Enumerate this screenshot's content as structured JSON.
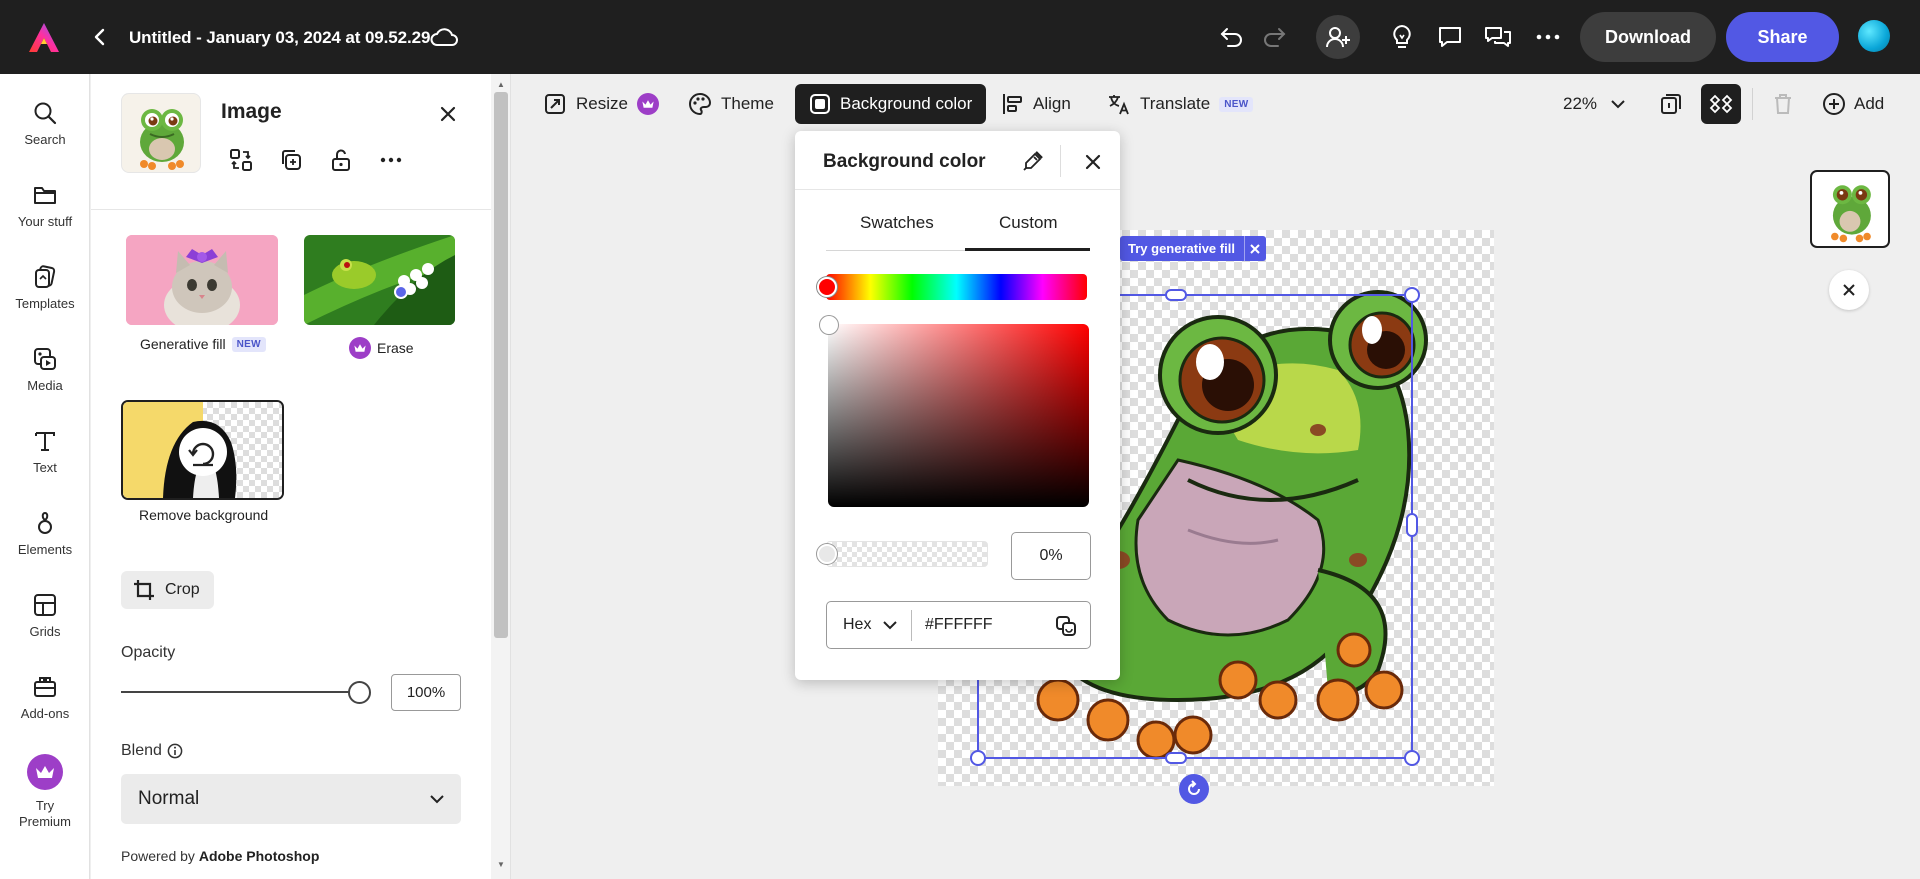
{
  "header": {
    "doc_title": "Untitled - January 03, 2024 at 09.52.29",
    "download_label": "Download",
    "share_label": "Share"
  },
  "rail": {
    "items": [
      {
        "label": "Search",
        "icon": "search-icon"
      },
      {
        "label": "Your stuff",
        "icon": "folder-icon"
      },
      {
        "label": "Templates",
        "icon": "templates-icon"
      },
      {
        "label": "Media",
        "icon": "media-icon"
      },
      {
        "label": "Text",
        "icon": "text-icon"
      },
      {
        "label": "Elements",
        "icon": "elements-icon"
      },
      {
        "label": "Grids",
        "icon": "grids-icon"
      },
      {
        "label": "Add-ons",
        "icon": "addons-icon"
      }
    ],
    "premium_label": "Try\nPremium"
  },
  "panel": {
    "title": "Image",
    "generative_fill_label": "Generative fill",
    "new_badge": "NEW",
    "erase_label": "Erase",
    "remove_bg_label": "Remove background",
    "crop_label": "Crop",
    "opacity_label": "Opacity",
    "opacity_value": "100%",
    "opacity_fraction": 1.0,
    "blend_label": "Blend",
    "blend_value": "Normal",
    "powered_prefix": "Powered by ",
    "powered_brand": "Adobe Photoshop"
  },
  "toolbar": {
    "resize_label": "Resize",
    "theme_label": "Theme",
    "bgcolor_label": "Background color",
    "align_label": "Align",
    "translate_label": "Translate",
    "translate_badge": "NEW",
    "zoom_value": "22%",
    "add_label": "Add"
  },
  "canvas": {
    "gen_fill_chip": "Try generative fill"
  },
  "bg_popover": {
    "title": "Background color",
    "tab_swatches": "Swatches",
    "tab_custom": "Custom",
    "selected_tab": "Custom",
    "alpha_value": "0%",
    "mode": "Hex",
    "hex_value": "#FFFFFF"
  },
  "colors": {
    "accent": "#5258e4",
    "premium": "#9d3ec7",
    "topbar": "#1f1f1f"
  }
}
